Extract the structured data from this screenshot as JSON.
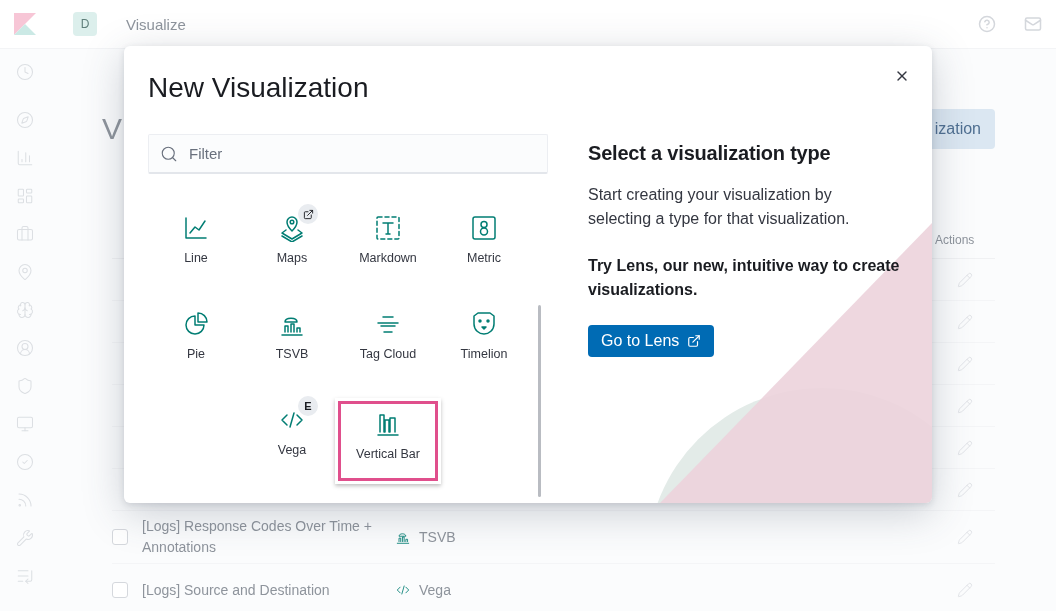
{
  "header": {
    "avatar": "D",
    "title": "Visualize"
  },
  "page": {
    "title": "V",
    "create_button": "ization",
    "table": {
      "action_column": "Actions",
      "rows": [
        {
          "kind": "covered"
        },
        {
          "kind": "covered"
        },
        {
          "kind": "covered"
        },
        {
          "kind": "covered"
        },
        {
          "kind": "covered"
        },
        {
          "kind": "covered"
        },
        {
          "kind": "visible",
          "checked": false,
          "name": "[Logs] Response Codes Over Time + Annotations",
          "type": {
            "kind": "tsvb",
            "label": "TSVB"
          }
        },
        {
          "kind": "visible",
          "checked": false,
          "name": "[Logs] Source and Destination",
          "type": {
            "kind": "vega",
            "label": "Vega"
          }
        }
      ]
    }
  },
  "modal": {
    "title": "New Visualization",
    "filter": {
      "placeholder": "Filter"
    },
    "type_rows": [
      [
        {
          "kind": "line",
          "label": "Line",
          "highlighted": false
        },
        {
          "kind": "maps",
          "label": "Maps",
          "highlighted": false,
          "badge": {
            "kind": "external"
          }
        },
        {
          "kind": "markdown",
          "label": "Markdown",
          "highlighted": false
        },
        {
          "kind": "metric",
          "label": "Metric",
          "highlighted": false
        }
      ],
      [
        {
          "kind": "pie",
          "label": "Pie",
          "highlighted": false
        },
        {
          "kind": "tsvb",
          "label": "TSVB",
          "highlighted": false
        },
        {
          "kind": "tagcloud",
          "label": "Tag Cloud",
          "highlighted": false
        },
        {
          "kind": "timelion",
          "label": "Timelion",
          "highlighted": false
        }
      ],
      [
        {
          "kind": "vega",
          "label": "Vega",
          "highlighted": false,
          "badge": {
            "kind": "letter",
            "text": "E"
          }
        },
        {
          "kind": "verticalbar",
          "label": "Vertical Bar",
          "highlighted": true
        }
      ]
    ],
    "heading": "Select a visualization type",
    "description": "Start creating your visualization by selecting a type for that visualization.",
    "lens_prompt": "Try Lens, our new, intuitive way to create visualizations.",
    "lens_button": "Go to Lens"
  }
}
